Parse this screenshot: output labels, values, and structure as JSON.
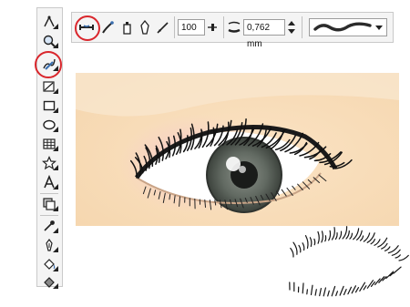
{
  "toolbox": {
    "tools": [
      {
        "name": "shape-tool-icon"
      },
      {
        "name": "zoom-tool-icon"
      },
      {
        "name": "freehand-tool-icon",
        "highlighted": true
      },
      {
        "name": "smart-fill-tool-icon"
      },
      {
        "name": "rectangle-tool-icon"
      },
      {
        "name": "ellipse-tool-icon"
      },
      {
        "name": "table-tool-icon"
      },
      {
        "name": "star-shape-icon"
      },
      {
        "name": "text-tool-icon"
      },
      {
        "name": "interactive-tool-icon"
      },
      {
        "name": "eyedropper-tool-icon"
      },
      {
        "name": "outline-pen-icon"
      },
      {
        "name": "fill-tool-icon"
      },
      {
        "name": "interactive-fill-icon"
      }
    ]
  },
  "propbar": {
    "preset_mode_icon": "preset-mode-icon",
    "brush_mode_icon": "brush-mode-icon",
    "sprayer_mode_icon": "sprayer-mode-icon",
    "calligraphic_mode_icon": "calligraphic-mode-icon",
    "pressure_mode_icon": "pressure-mode-icon",
    "smoothing_value": "100",
    "stroke_width_value": "0,762 mm",
    "stroke_preset": "stroke-preset-wave"
  },
  "colors": {
    "highlight": "#d9262c",
    "skin": "#f8ddb8",
    "iris": "#5f675f",
    "eye_shadow": "#f3bfcd"
  }
}
